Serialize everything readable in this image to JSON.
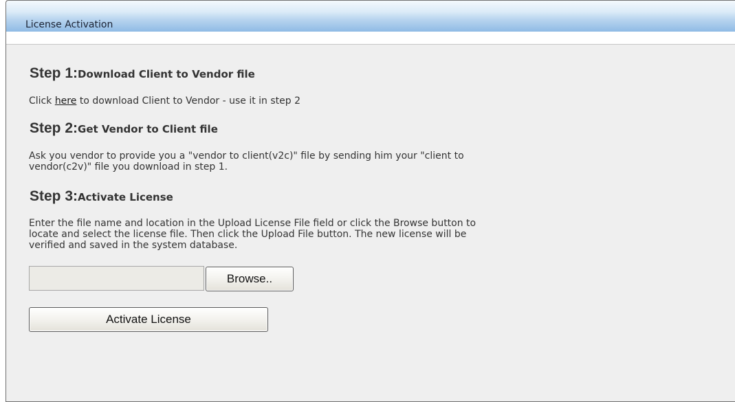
{
  "panel": {
    "title": "License Activation"
  },
  "steps": [
    {
      "number": "Step 1:",
      "title": "Download Client to Vendor file",
      "desc_prefix": "Click ",
      "link_text": "here",
      "desc_suffix": " to download Client to Vendor - use it in step 2"
    },
    {
      "number": "Step 2:",
      "title": "Get Vendor to Client file",
      "desc_line1": "Ask you vendor to provide you a \"vendor to client(v2c)\" file by sending him your \"client to",
      "desc_line2": "vendor(c2v)\" file you download in step 1."
    },
    {
      "number": "Step 3:",
      "title": "Activate License",
      "desc_line1": "Enter the file name and location in the Upload License File field or click the Browse button to",
      "desc_line2": "locate and select the license file. Then click the Upload File button. The new license will be",
      "desc_line3": "verified and saved in the system database."
    }
  ],
  "upload": {
    "file_value": "",
    "browse_label": "Browse..",
    "activate_label": "Activate License"
  }
}
